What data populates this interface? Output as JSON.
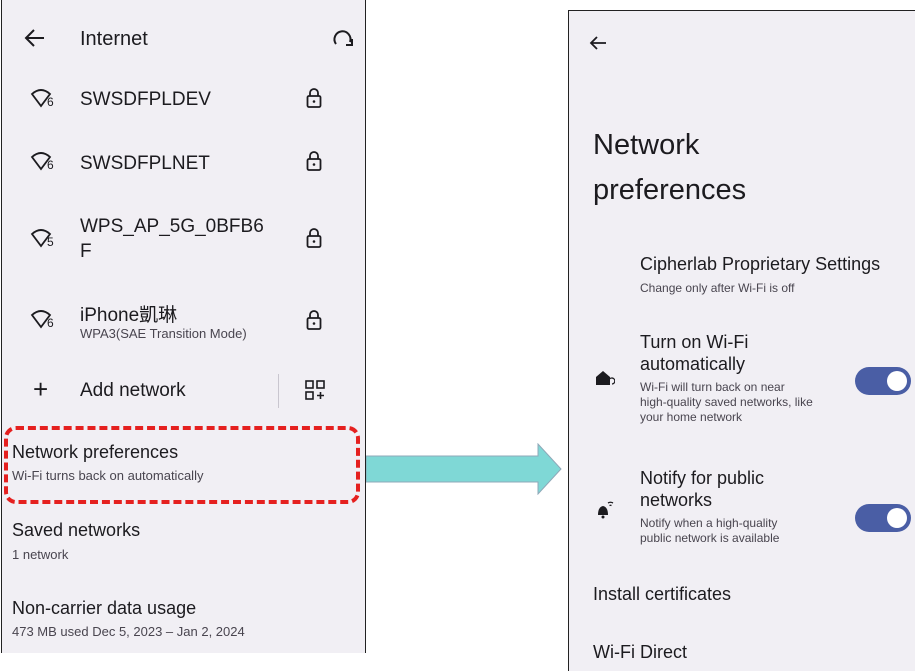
{
  "left": {
    "header": {
      "title": "Internet"
    },
    "networks": [
      {
        "ssid": "SWSDFPLDEV",
        "sub": "",
        "badge": "6"
      },
      {
        "ssid": "SWSDFPLNET",
        "sub": "",
        "badge": "6"
      },
      {
        "ssid_line1": "WPS_AP_5G_0BFB6",
        "ssid_line2": "F",
        "sub": "",
        "badge": "5"
      },
      {
        "ssid": "iPhone凱琳",
        "sub": "WPA3(SAE Transition Mode)",
        "badge": "6"
      }
    ],
    "add_network": "Add network",
    "network_prefs": {
      "title": "Network preferences",
      "sub": "Wi-Fi turns back on automatically"
    },
    "saved_networks": {
      "title": "Saved networks",
      "sub": "1 network"
    },
    "non_carrier": {
      "title": "Non-carrier data usage",
      "sub": "473 MB used Dec 5, 2023 – Jan 2, 2024"
    }
  },
  "right": {
    "title_line1": "Network",
    "title_line2": "preferences",
    "cipherlab": {
      "title": "Cipherlab Proprietary Settings",
      "sub": "Change only after Wi-Fi is off"
    },
    "turn_on": {
      "title_line1": "Turn on Wi-Fi",
      "title_line2": "automatically",
      "sub_line1": "Wi-Fi will turn back on near",
      "sub_line2": "high-quality saved networks, like",
      "sub_line3": "your home network",
      "enabled": true
    },
    "notify": {
      "title_line1": "Notify for public",
      "title_line2": "networks",
      "sub_line1": "Notify when a high-quality",
      "sub_line2": "public network is available",
      "enabled": true
    },
    "install_certs": "Install certificates",
    "wifi_direct": "Wi-Fi Direct"
  },
  "colors": {
    "highlight": "#e5201f",
    "arrow": "#7fd8d6",
    "toggle": "#4a5ea5",
    "panel": "#f1eff4"
  }
}
